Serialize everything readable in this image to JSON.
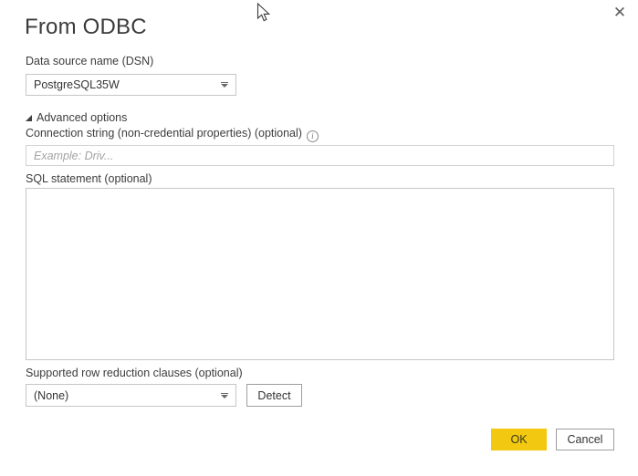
{
  "dialog": {
    "title": "From ODBC",
    "close_glyph": "✕"
  },
  "dsn": {
    "label": "Data source name (DSN)",
    "value": "PostgreSQL35W"
  },
  "advanced": {
    "label": "Advanced options",
    "expanded": true
  },
  "connection_string": {
    "label": "Connection string (non-credential properties) (optional)",
    "info_glyph": "i",
    "placeholder": "Example: Driv...",
    "value": ""
  },
  "sql": {
    "label": "SQL statement (optional)",
    "value": ""
  },
  "row_reduction": {
    "label": "Supported row reduction clauses (optional)",
    "value": "(None)",
    "detect_label": "Detect"
  },
  "footer": {
    "ok_label": "OK",
    "cancel_label": "Cancel"
  },
  "colors": {
    "accent_yellow": "#f2c811",
    "input_border": "#c6c6c6",
    "text": "#333333"
  }
}
